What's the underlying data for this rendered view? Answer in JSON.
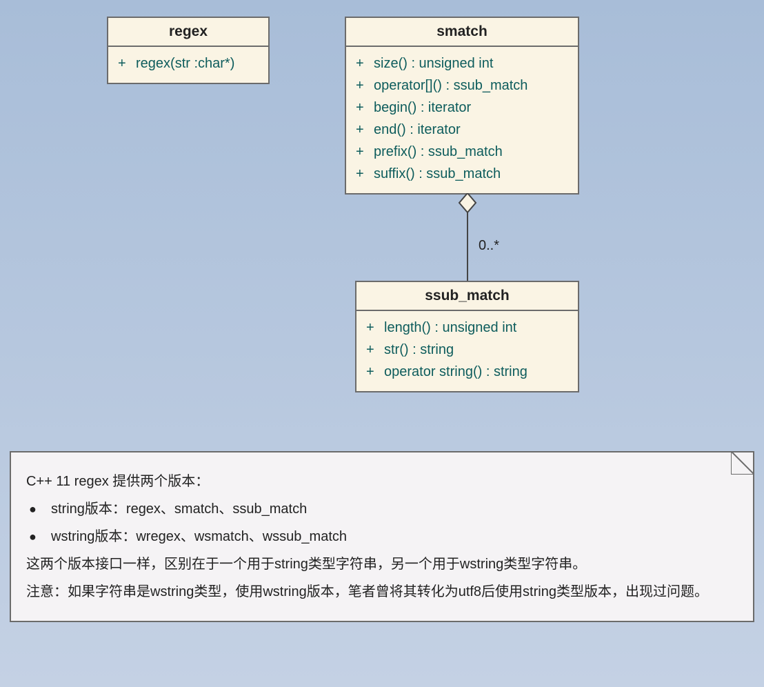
{
  "classes": {
    "regex": {
      "title": "regex",
      "members": [
        {
          "vis": "+",
          "sig": "regex(str :char*)"
        }
      ]
    },
    "smatch": {
      "title": "smatch",
      "members": [
        {
          "vis": "+",
          "sig": "size() : unsigned int"
        },
        {
          "vis": "+",
          "sig": "operator[]() : ssub_match"
        },
        {
          "vis": "+",
          "sig": "begin() : iterator"
        },
        {
          "vis": "+",
          "sig": "end() : iterator"
        },
        {
          "vis": "+",
          "sig": "prefix() : ssub_match"
        },
        {
          "vis": "+",
          "sig": "suffix() : ssub_match"
        }
      ]
    },
    "ssub_match": {
      "title": "ssub_match",
      "members": [
        {
          "vis": "+",
          "sig": "length() : unsigned int"
        },
        {
          "vis": "+",
          "sig": "str() : string"
        },
        {
          "vis": "+",
          "sig": "operator string() : string"
        }
      ]
    }
  },
  "relationship": {
    "multiplicity": "0..*"
  },
  "note": {
    "line1": "C++ 11 regex 提供两个版本：",
    "bullet1": "string版本：regex、smatch、ssub_match",
    "bullet2": "wstring版本：wregex、wsmatch、wssub_match",
    "line2": "这两个版本接口一样，区别在于一个用于string类型字符串，另一个用于wstring类型字符串。",
    "line3": "注意：如果字符串是wstring类型，使用wstring版本，笔者曾将其转化为utf8后使用string类型版本，出现过问题。"
  }
}
